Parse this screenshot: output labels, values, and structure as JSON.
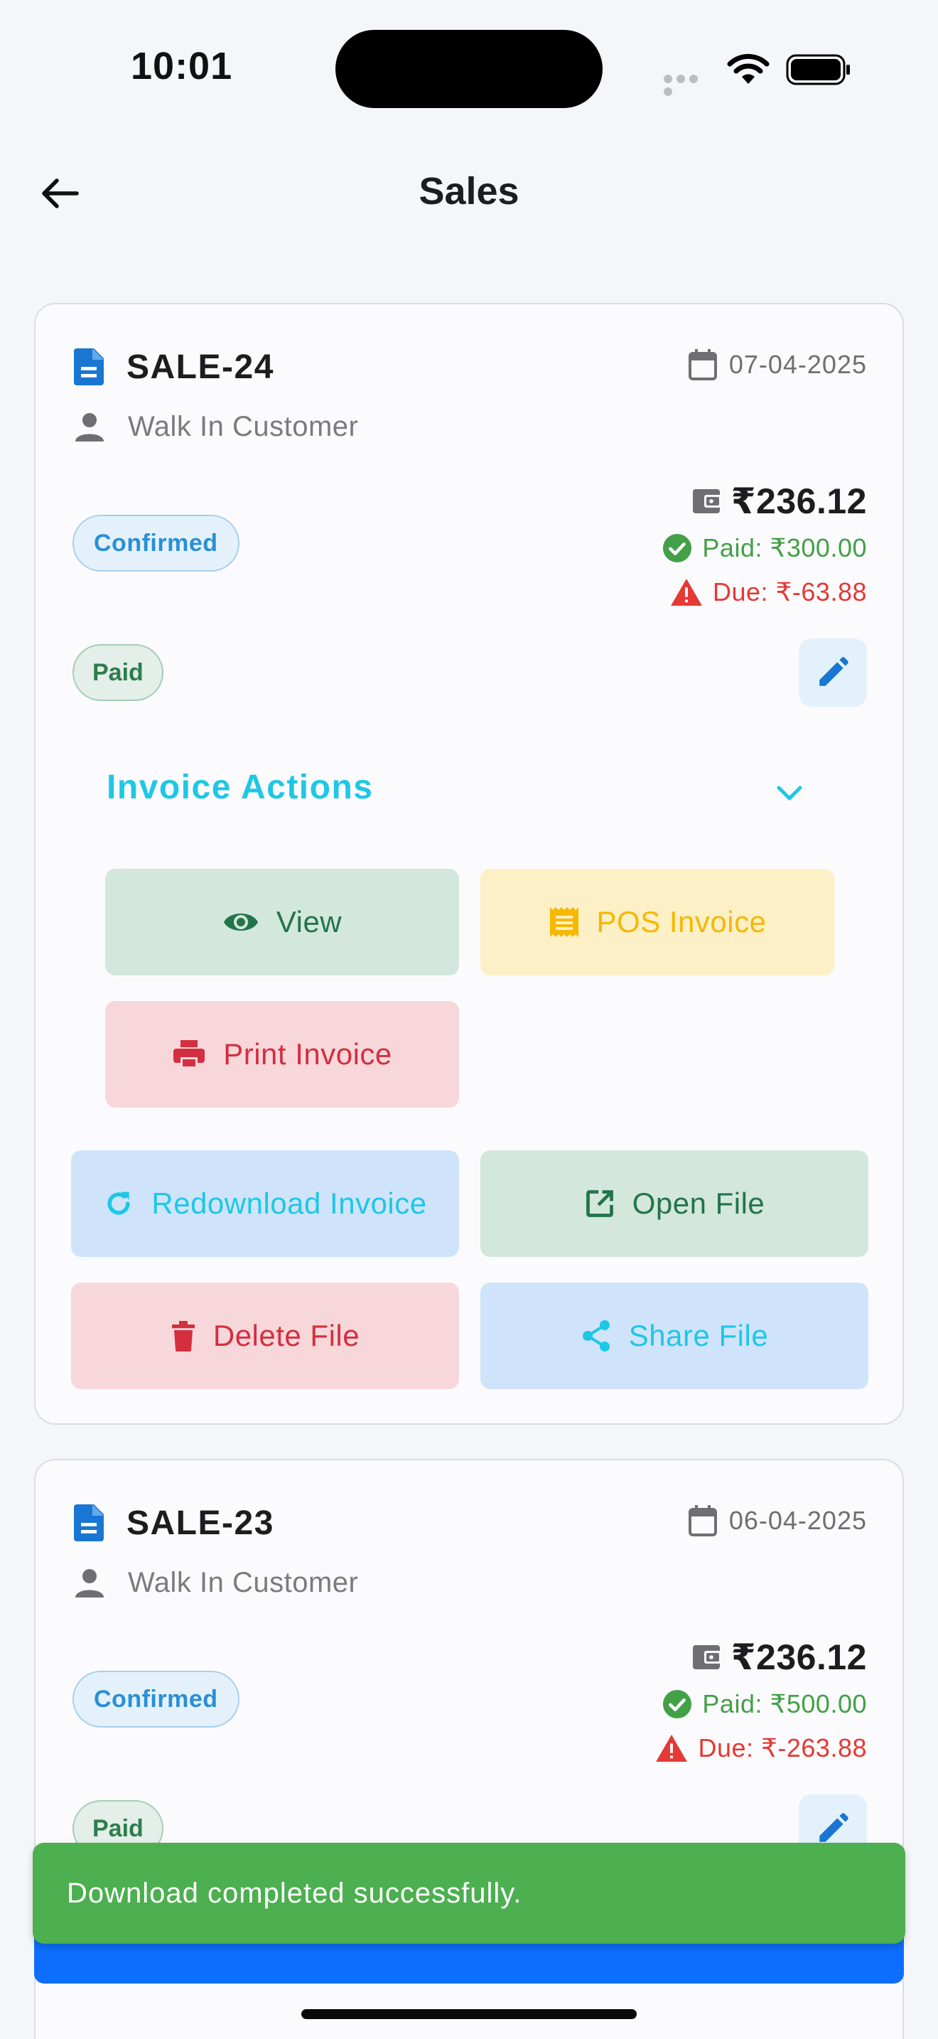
{
  "status_bar": {
    "time": "10:01"
  },
  "app_bar": {
    "title": "Sales"
  },
  "sales": [
    {
      "id": "SALE-24",
      "date": "07-04-2025",
      "customer": "Walk In Customer",
      "total": "₹236.12",
      "paid": "Paid: ₹300.00",
      "due": "Due: ₹-63.88",
      "status": "Confirmed",
      "payment_status": "Paid",
      "invoice_actions": {
        "title": "Invoice Actions",
        "view": "View",
        "pos_invoice": "POS Invoice",
        "print_invoice": "Print Invoice"
      },
      "file_actions": {
        "redownload": "Redownload Invoice",
        "open": "Open File",
        "delete": "Delete File",
        "share": "Share File"
      }
    },
    {
      "id": "SALE-23",
      "date": "06-04-2025",
      "customer": "Walk In Customer",
      "total": "₹236.12",
      "paid": "Paid: ₹500.00",
      "due": "Due: ₹-263.88",
      "status": "Confirmed",
      "payment_status": "Paid"
    }
  ],
  "snackbar": {
    "message": "Download completed successfully."
  },
  "colors": {
    "accent_blue": "#1976d2",
    "cyan": "#1ec7e6",
    "success": "#4caf50",
    "danger": "#e53935"
  },
  "icons": [
    "arrow-back-icon",
    "document-icon",
    "calendar-icon",
    "person-icon",
    "wallet-icon",
    "check-circle-icon",
    "warning-icon",
    "edit-icon",
    "chevron-down-icon",
    "eye-icon",
    "receipt-icon",
    "printer-icon",
    "refresh-icon",
    "open-external-icon",
    "trash-icon",
    "share-icon",
    "wifi-icon",
    "battery-icon"
  ]
}
